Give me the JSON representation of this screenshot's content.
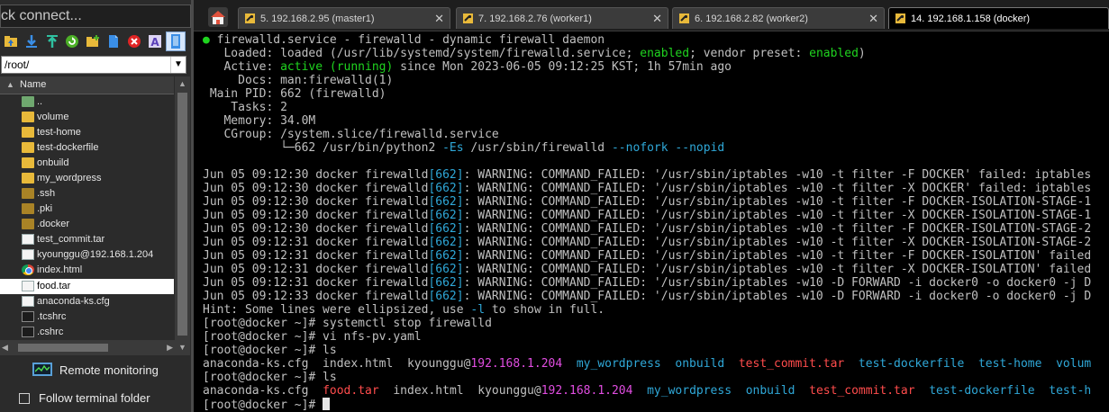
{
  "quick_connect": {
    "placeholder": "ck connect..."
  },
  "toolbar": {
    "icons": [
      "folder-up-icon",
      "download-icon",
      "upload-icon",
      "refresh-icon",
      "new-folder-icon",
      "new-file-icon",
      "delete-icon",
      "rename-icon",
      "terminal-sync-icon"
    ]
  },
  "file_browser": {
    "path": "/root/",
    "column_header": "Name",
    "items": [
      {
        "name": "..",
        "icon": "parent-folder-icon"
      },
      {
        "name": "volume",
        "icon": "folder-icon"
      },
      {
        "name": "test-home",
        "icon": "folder-icon"
      },
      {
        "name": "test-dockerfile",
        "icon": "folder-icon"
      },
      {
        "name": "onbuild",
        "icon": "folder-icon"
      },
      {
        "name": "my_wordpress",
        "icon": "folder-icon"
      },
      {
        "name": ".ssh",
        "icon": "hidden-folder-icon"
      },
      {
        "name": ".pki",
        "icon": "hidden-folder-icon"
      },
      {
        "name": ".docker",
        "icon": "hidden-folder-icon"
      },
      {
        "name": "test_commit.tar",
        "icon": "archive-file-icon"
      },
      {
        "name": "kyounggu@192.168.1.204",
        "icon": "file-icon"
      },
      {
        "name": "index.html",
        "icon": "chrome-icon"
      },
      {
        "name": "food.tar",
        "icon": "archive-file-icon",
        "selected": true
      },
      {
        "name": "anaconda-ks.cfg",
        "icon": "file-icon"
      },
      {
        "name": ".tcshrc",
        "icon": "terminal-file-icon"
      },
      {
        "name": ".cshrc",
        "icon": "terminal-file-icon"
      }
    ]
  },
  "remote_monitoring": {
    "label": "Remote monitoring"
  },
  "follow_terminal": {
    "label": "Follow terminal folder",
    "checked": false
  },
  "tabs": [
    {
      "label": "5. 192.168.2.95 (master1)",
      "active": false
    },
    {
      "label": "7. 192.168.2.76 (worker1)",
      "active": false
    },
    {
      "label": "6. 192.168.2.82 (worker2)",
      "active": false
    },
    {
      "label": "14. 192.168.1.158 (docker)",
      "active": true
    }
  ],
  "terminal": {
    "lines": [
      [
        {
          "t": "● ",
          "c": "g"
        },
        {
          "t": "firewalld.service - firewalld - dynamic firewall daemon"
        }
      ],
      [
        {
          "t": "   Loaded: loaded (/usr/lib/systemd/system/firewalld.service; "
        },
        {
          "t": "enabled",
          "c": "g"
        },
        {
          "t": "; vendor preset: "
        },
        {
          "t": "enabled",
          "c": "g"
        },
        {
          "t": ")"
        }
      ],
      [
        {
          "t": "   Active: "
        },
        {
          "t": "active (running)",
          "c": "g"
        },
        {
          "t": " since Mon 2023-06-05 09:12:25 KST; 1h 57min ago"
        }
      ],
      [
        {
          "t": "     Docs: man:firewalld(1)"
        }
      ],
      [
        {
          "t": " Main PID: 662 (firewalld)"
        }
      ],
      [
        {
          "t": "    Tasks: 2"
        }
      ],
      [
        {
          "t": "   Memory: 34.0M"
        }
      ],
      [
        {
          "t": "   CGroup: /system.slice/firewalld.service"
        }
      ],
      [
        {
          "t": "           └─662 /usr/bin/python2 "
        },
        {
          "t": "-Es",
          "c": "b"
        },
        {
          "t": " /usr/sbin/firewalld "
        },
        {
          "t": "--nofork",
          "c": "b"
        },
        {
          "t": " "
        },
        {
          "t": "--nopid",
          "c": "b"
        }
      ],
      [
        {
          "t": ""
        }
      ],
      [
        {
          "t": "Jun 05 09:12:30 docker firewalld"
        },
        {
          "t": "[662]",
          "c": "b"
        },
        {
          "t": ": WARNING: COMMAND_FAILED: '/usr/sbin/iptables -w10 -t filter -F DOCKER' failed: iptables"
        }
      ],
      [
        {
          "t": "Jun 05 09:12:30 docker firewalld"
        },
        {
          "t": "[662]",
          "c": "b"
        },
        {
          "t": ": WARNING: COMMAND_FAILED: '/usr/sbin/iptables -w10 -t filter -X DOCKER' failed: iptables"
        }
      ],
      [
        {
          "t": "Jun 05 09:12:30 docker firewalld"
        },
        {
          "t": "[662]",
          "c": "b"
        },
        {
          "t": ": WARNING: COMMAND_FAILED: '/usr/sbin/iptables -w10 -t filter -F DOCKER-ISOLATION-STAGE-1"
        }
      ],
      [
        {
          "t": "Jun 05 09:12:30 docker firewalld"
        },
        {
          "t": "[662]",
          "c": "b"
        },
        {
          "t": ": WARNING: COMMAND_FAILED: '/usr/sbin/iptables -w10 -t filter -X DOCKER-ISOLATION-STAGE-1"
        }
      ],
      [
        {
          "t": "Jun 05 09:12:30 docker firewalld"
        },
        {
          "t": "[662]",
          "c": "b"
        },
        {
          "t": ": WARNING: COMMAND_FAILED: '/usr/sbin/iptables -w10 -t filter -F DOCKER-ISOLATION-STAGE-2"
        }
      ],
      [
        {
          "t": "Jun 05 09:12:31 docker firewalld"
        },
        {
          "t": "[662]",
          "c": "b"
        },
        {
          "t": ": WARNING: COMMAND_FAILED: '/usr/sbin/iptables -w10 -t filter -X DOCKER-ISOLATION-STAGE-2"
        }
      ],
      [
        {
          "t": "Jun 05 09:12:31 docker firewalld"
        },
        {
          "t": "[662]",
          "c": "b"
        },
        {
          "t": ": WARNING: COMMAND_FAILED: '/usr/sbin/iptables -w10 -t filter -F DOCKER-ISOLATION' failed"
        }
      ],
      [
        {
          "t": "Jun 05 09:12:31 docker firewalld"
        },
        {
          "t": "[662]",
          "c": "b"
        },
        {
          "t": ": WARNING: COMMAND_FAILED: '/usr/sbin/iptables -w10 -t filter -X DOCKER-ISOLATION' failed"
        }
      ],
      [
        {
          "t": "Jun 05 09:12:31 docker firewalld"
        },
        {
          "t": "[662]",
          "c": "b"
        },
        {
          "t": ": WARNING: COMMAND_FAILED: '/usr/sbin/iptables -w10 -D FORWARD -i docker0 -o docker0 -j D"
        }
      ],
      [
        {
          "t": "Jun 05 09:12:33 docker firewalld"
        },
        {
          "t": "[662]",
          "c": "b"
        },
        {
          "t": ": WARNING: COMMAND_FAILED: '/usr/sbin/iptables -w10 -D FORWARD -i docker0 -o docker0 -j D"
        }
      ],
      [
        {
          "t": "Hint: Some lines were ellipsized, use "
        },
        {
          "t": "-l",
          "c": "b"
        },
        {
          "t": " to show in full."
        }
      ],
      [
        {
          "t": "[root@docker ~]# systemctl stop firewalld"
        }
      ],
      [
        {
          "t": "[root@docker ~]# vi nfs-pv.yaml"
        }
      ],
      [
        {
          "t": "[root@docker ~]# ls"
        }
      ],
      [
        {
          "t": "anaconda-ks.cfg  index.html  kyounggu@"
        },
        {
          "t": "192.168.1.204",
          "c": "m"
        },
        {
          "t": "  "
        },
        {
          "t": "my_wordpress",
          "c": "b"
        },
        {
          "t": "  "
        },
        {
          "t": "onbuild",
          "c": "b"
        },
        {
          "t": "  "
        },
        {
          "t": "test_commit.tar",
          "c": "r"
        },
        {
          "t": "  "
        },
        {
          "t": "test-dockerfile",
          "c": "b"
        },
        {
          "t": "  "
        },
        {
          "t": "test-home",
          "c": "b"
        },
        {
          "t": "  "
        },
        {
          "t": "volum",
          "c": "b"
        }
      ],
      [
        {
          "t": "[root@docker ~]# ls"
        }
      ],
      [
        {
          "t": "anaconda-ks.cfg  "
        },
        {
          "t": "food.tar",
          "c": "r"
        },
        {
          "t": "  index.html  kyounggu@"
        },
        {
          "t": "192.168.1.204",
          "c": "m"
        },
        {
          "t": "  "
        },
        {
          "t": "my_wordpress",
          "c": "b"
        },
        {
          "t": "  "
        },
        {
          "t": "onbuild",
          "c": "b"
        },
        {
          "t": "  "
        },
        {
          "t": "test_commit.tar",
          "c": "r"
        },
        {
          "t": "  "
        },
        {
          "t": "test-dockerfile",
          "c": "b"
        },
        {
          "t": "  "
        },
        {
          "t": "test-h",
          "c": "b"
        }
      ],
      [
        {
          "t": "[root@docker ~]# "
        },
        {
          "cursor": true
        }
      ]
    ]
  }
}
